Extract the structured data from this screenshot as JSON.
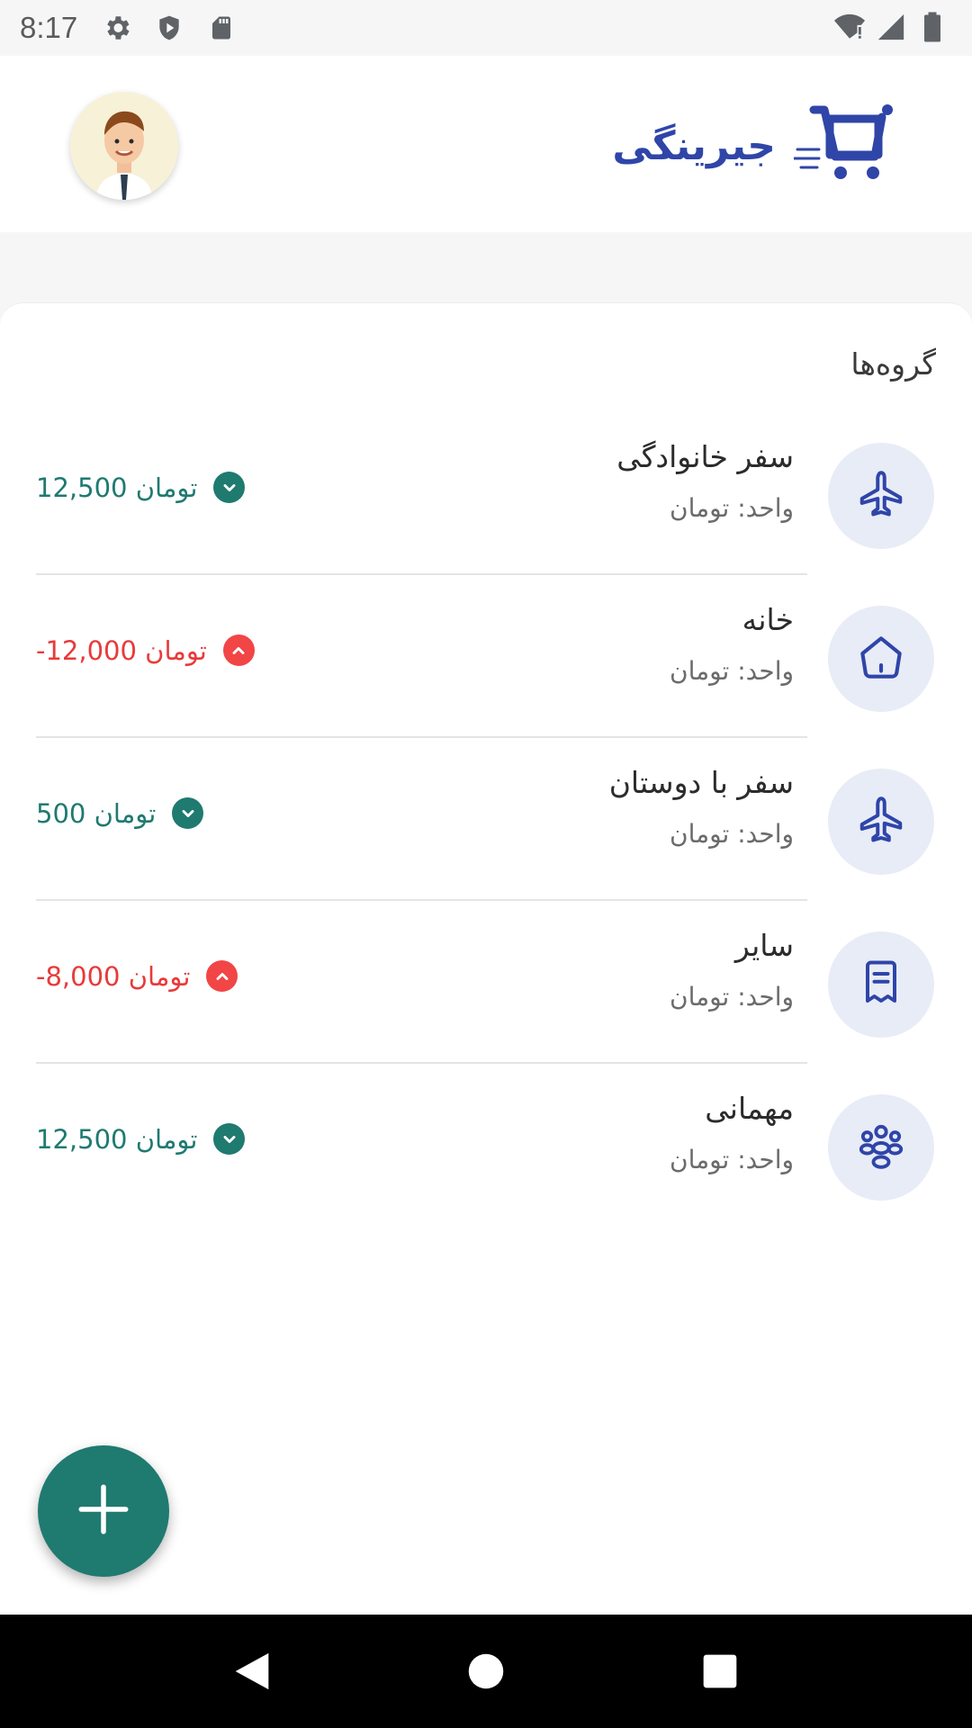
{
  "status_bar": {
    "time": "8:17",
    "left_icons": [
      "settings-icon",
      "shield-icon",
      "sd-card-icon"
    ],
    "right_icons": [
      "wifi-icon",
      "signal-icon",
      "battery-icon"
    ]
  },
  "header": {
    "brand_name": "جیرینگی",
    "logo_icon": "shopping-cart-icon",
    "avatar_icon": "user-avatar"
  },
  "groups_section": {
    "title": "گروه‌ها",
    "items": [
      {
        "name": "سفر خانوادگی",
        "unit": "واحد: تومان",
        "balance": "12,500 تومان",
        "status": "positive",
        "icon": "airplane-icon"
      },
      {
        "name": "خانه",
        "unit": "واحد: تومان",
        "balance": "-12,000 تومان",
        "status": "negative",
        "icon": "home-icon"
      },
      {
        "name": "سفر با دوستان",
        "unit": "واحد: تومان",
        "balance": "500 تومان",
        "status": "positive",
        "icon": "airplane-icon"
      },
      {
        "name": "سایر",
        "unit": "واحد: تومان",
        "balance": "-8,000 تومان",
        "status": "negative",
        "icon": "receipt-icon"
      },
      {
        "name": "مهمانی",
        "unit": "واحد: تومان",
        "balance": "12,500 تومان",
        "status": "positive",
        "icon": "people-icon"
      }
    ]
  },
  "fab": {
    "icon": "plus-icon"
  },
  "colors": {
    "brand": "#2f45a8",
    "positive": "#1f7a70",
    "negative": "#e83a3a",
    "icon_bg": "#e8ecf7"
  },
  "nav": {
    "back": "back-icon",
    "home": "home-circle-icon",
    "recents": "recents-icon"
  }
}
